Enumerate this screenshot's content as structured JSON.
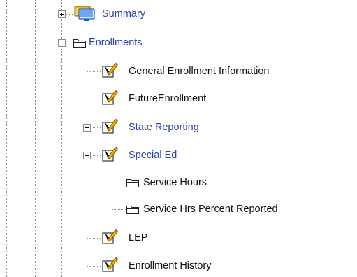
{
  "tree": {
    "nodes": [
      {
        "label": "Summary",
        "icon": "summary-monitor-icon",
        "toggle": "plus",
        "style": "link"
      },
      {
        "label": "Enrollments",
        "icon": "folder-icon",
        "toggle": "minus",
        "style": "link"
      },
      {
        "label": "General Enrollment Information",
        "icon": "edit-note-icon",
        "style": "plain"
      },
      {
        "label": "FutureEnrollment",
        "icon": "edit-note-icon",
        "style": "plain"
      },
      {
        "label": "State Reporting",
        "icon": "edit-note-icon",
        "toggle": "plus",
        "style": "link"
      },
      {
        "label": "Special Ed",
        "icon": "edit-note-icon",
        "toggle": "minus",
        "style": "link"
      },
      {
        "label": "Service Hours",
        "icon": "folder-icon",
        "style": "plain"
      },
      {
        "label": "Service Hrs Percent Reported",
        "icon": "folder-icon",
        "style": "plain"
      },
      {
        "label": "LEP",
        "icon": "edit-note-icon",
        "style": "plain"
      },
      {
        "label": "Enrollment History",
        "icon": "edit-note-icon",
        "style": "plain"
      }
    ]
  },
  "colors": {
    "link": "#2a3fa8",
    "plain": "#111111",
    "connector": "#8a8a8a"
  }
}
